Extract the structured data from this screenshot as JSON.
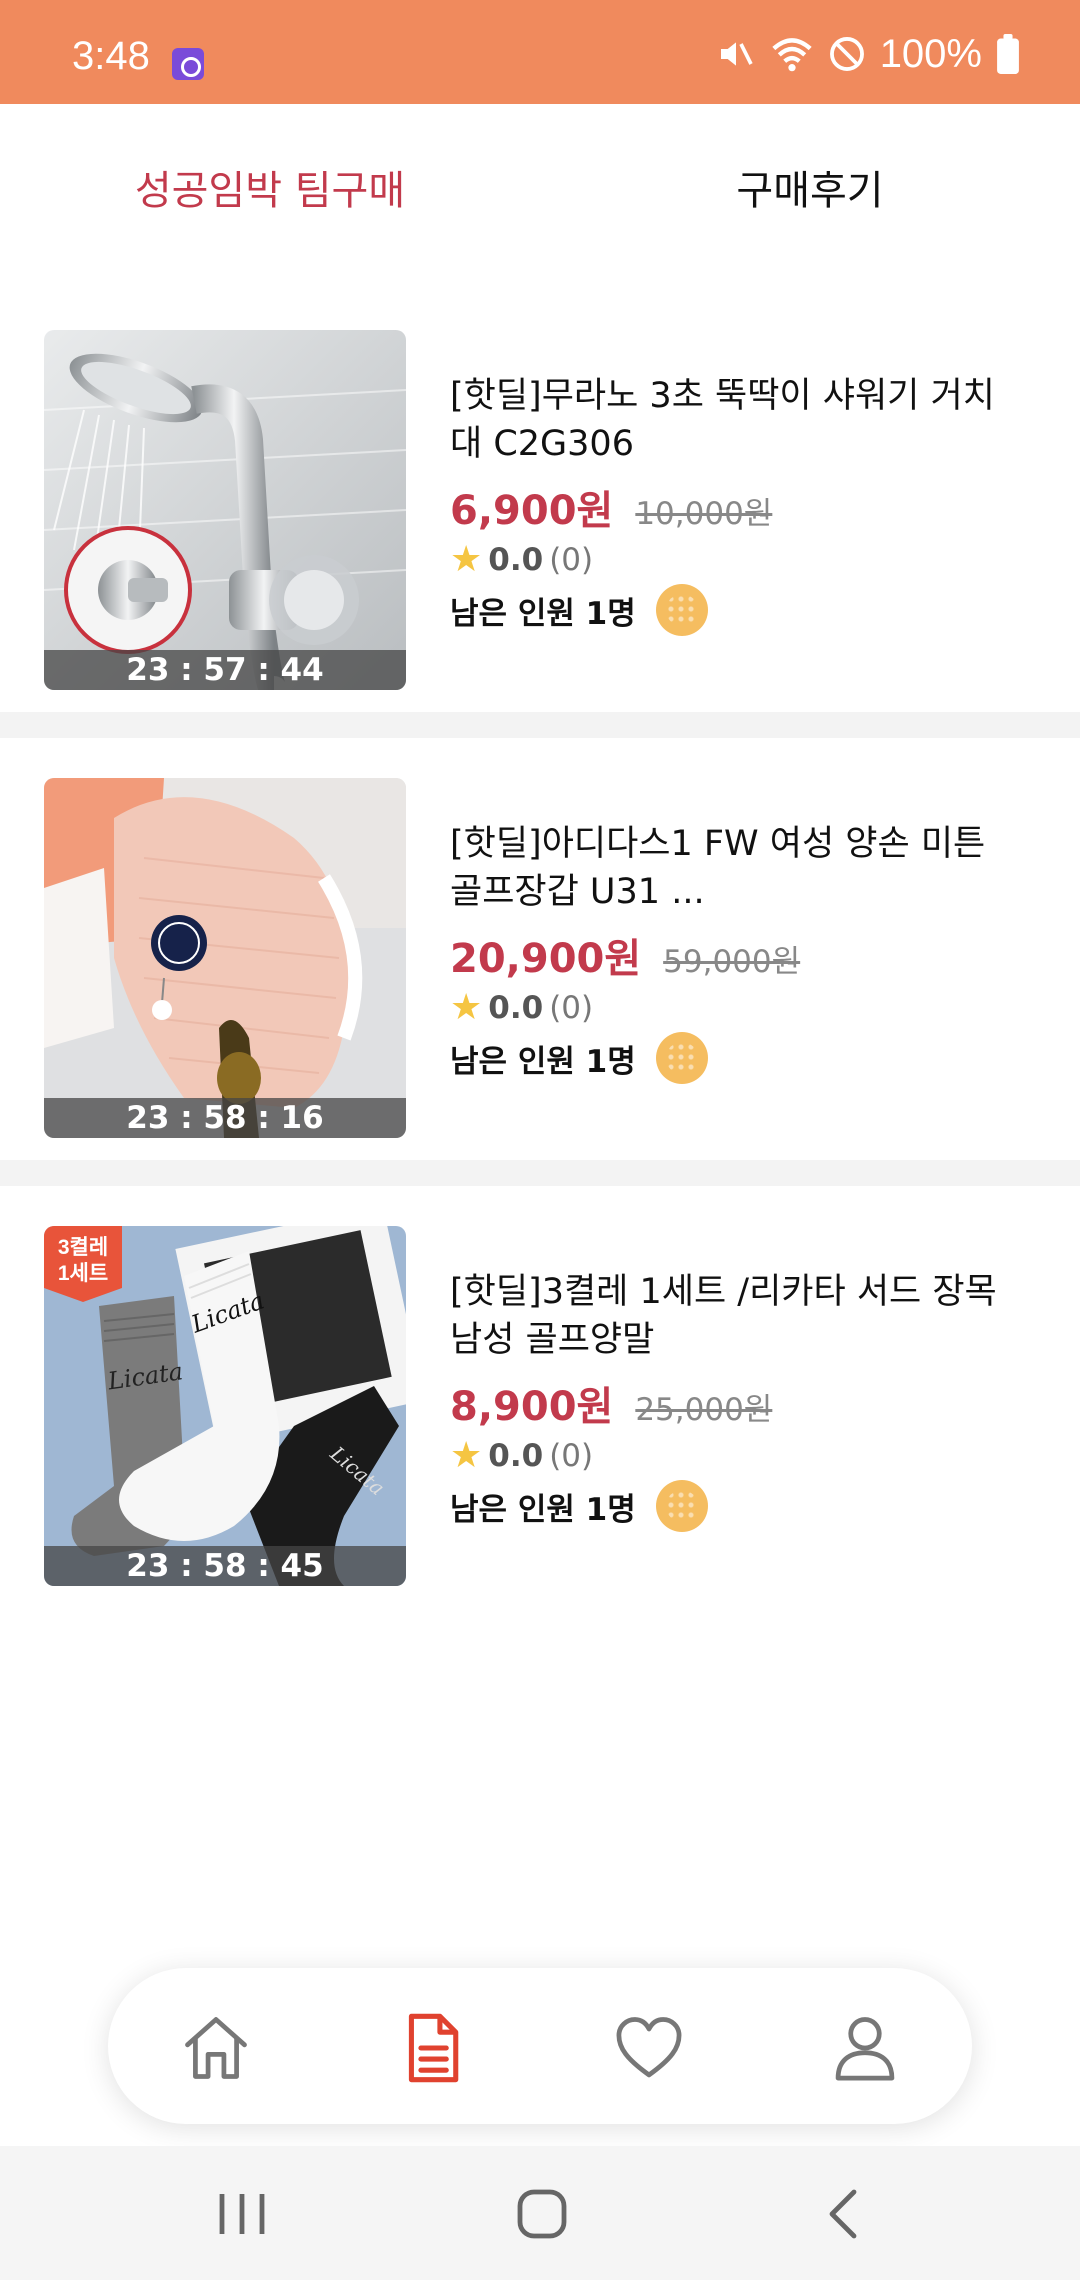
{
  "status_bar": {
    "time": "3:48",
    "battery": "100%",
    "icons": [
      "app-notification-icon",
      "mute-icon",
      "wifi-icon",
      "no-disturb-icon",
      "battery-icon"
    ]
  },
  "tabs": [
    {
      "label": "성공임박 팀구매",
      "selected": true
    },
    {
      "label": "구매후기",
      "selected": false
    }
  ],
  "products": [
    {
      "title": "[핫딜]무라노 3초 뚝딱이 샤워기 거치대 C2G306",
      "price": "6,900원",
      "original_price": "10,000원",
      "rating": "0.0",
      "review_count": "(0)",
      "remaining": "남은 인원 1명",
      "timer": "23 : 57 : 44"
    },
    {
      "title": "[핫딜]아디다스1 FW 여성 양손 미튼 골프장갑 U31 ...",
      "price": "20,900원",
      "original_price": "59,000원",
      "rating": "0.0",
      "review_count": "(0)",
      "remaining": "남은 인원 1명",
      "timer": "23 : 58 : 16"
    },
    {
      "title": "[핫딜]3켤레 1세트 /리카타 서드 장목 남성 골프양말",
      "price": "8,900원",
      "original_price": "25,000원",
      "rating": "0.0",
      "review_count": "(0)",
      "remaining": "남은 인원 1명",
      "timer": "23 : 58 : 45",
      "badge": "3켤레\n1세트"
    }
  ],
  "bottom_nav": {
    "items": [
      "home-icon",
      "orders-icon",
      "heart-icon",
      "profile-icon"
    ],
    "active": "orders-icon"
  },
  "colors": {
    "status_bar": "#f08a5d",
    "accent": "#c23a4c",
    "star": "#f5c542",
    "avatar": "#f5bd60"
  }
}
